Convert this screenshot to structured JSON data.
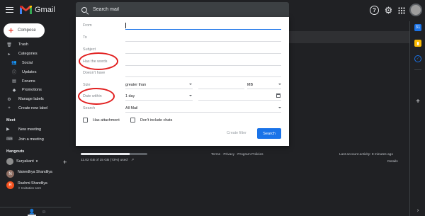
{
  "app": {
    "brand": "Gmail"
  },
  "search": {
    "placeholder": "Search mail"
  },
  "compose": {
    "label": "Compose"
  },
  "sidebar": {
    "items": [
      {
        "label": "Trash",
        "icon": "trash-icon"
      },
      {
        "label": "Categories",
        "icon": "label-icon"
      },
      {
        "label": "Social",
        "icon": "people-icon"
      },
      {
        "label": "Updates",
        "icon": "info-icon"
      },
      {
        "label": "Forums",
        "icon": "forum-icon"
      },
      {
        "label": "Promotions",
        "icon": "tag-icon"
      },
      {
        "label": "Manage labels",
        "icon": "gear-icon"
      },
      {
        "label": "Create new label",
        "icon": "plus-icon"
      }
    ]
  },
  "meet": {
    "title": "Meet",
    "new_meeting": "New meeting",
    "join_meeting": "Join a meeting"
  },
  "hangouts": {
    "title": "Hangouts",
    "user": "Suryakant",
    "contacts": [
      {
        "name": "Naivedhya Shandilya",
        "initial": "N",
        "status": "",
        "color": "#8d6e63"
      },
      {
        "name": "Rashmi Shandilya",
        "initial": "R",
        "status": "Invitation sent",
        "color": "#f4511e"
      }
    ]
  },
  "filter": {
    "from_label": "From",
    "to_label": "To",
    "subject_label": "Subject",
    "has_words_label": "Has the words",
    "doesnt_have_label": "Doesn't have",
    "size_label": "Size",
    "size_operator": "greater than",
    "size_unit": "MB",
    "date_within_label": "Date within",
    "date_within_value": "1 day",
    "search_label": "Search",
    "search_scope": "All Mail",
    "has_attachment": "Has attachment",
    "exclude_chats": "Don't include chats",
    "create_filter": "Create filter",
    "search_button": "Search"
  },
  "storage": {
    "text": "11.02 GB of 15 GB (73%) used",
    "fraction": 0.73
  },
  "footer": {
    "links": "Terms · Privacy · Program Policies",
    "activity": "Last account activity: 8 minutes ago",
    "details": "Details"
  },
  "colors": {
    "background": "#202124",
    "accent": "#1a73e8",
    "annotation": "#e11f1f"
  }
}
